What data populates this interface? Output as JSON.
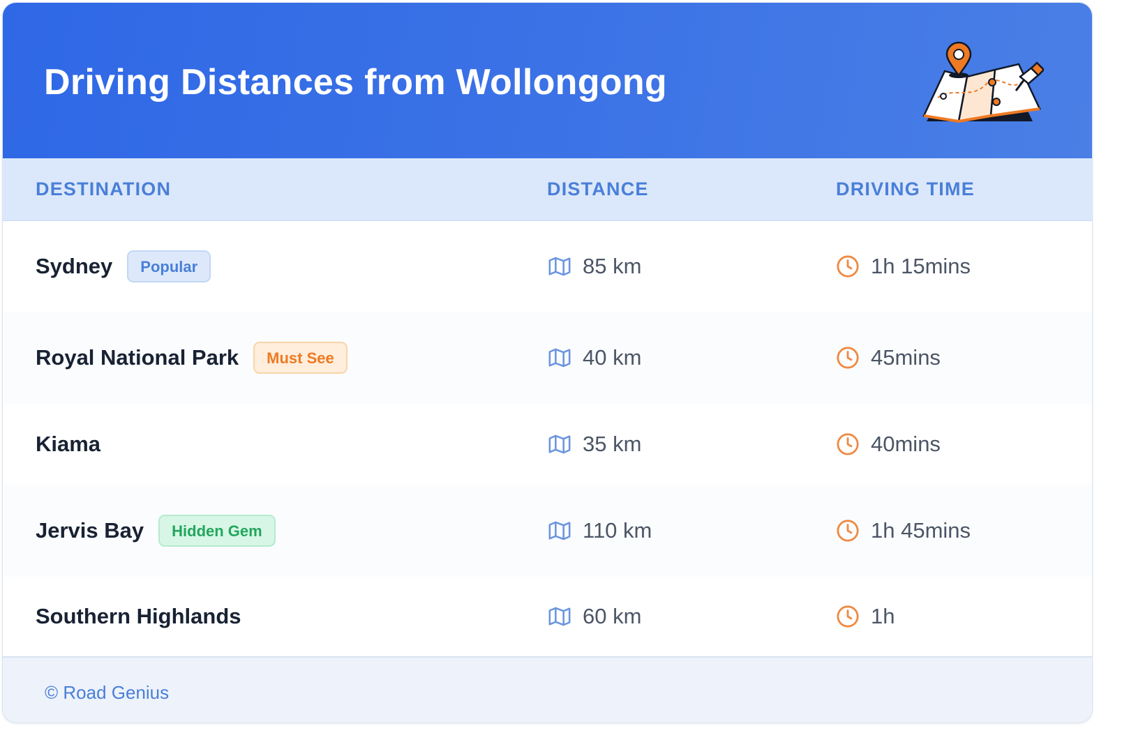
{
  "header": {
    "title": "Driving Distances from Wollongong",
    "illustration": "map-with-pins-icon"
  },
  "table": {
    "columns": [
      "DESTINATION",
      "DISTANCE",
      "DRIVING TIME"
    ],
    "rows": [
      {
        "destination": "Sydney",
        "badge": "Popular",
        "badge_color": "#4a7fd8",
        "distance": "85 km",
        "time": "1h 15mins"
      },
      {
        "destination": "Royal National Park",
        "badge": "Must See",
        "badge_color": "#ee7a23",
        "distance": "40 km",
        "time": "45mins"
      },
      {
        "destination": "Kiama",
        "badge": "",
        "badge_color": "",
        "distance": "35 km",
        "time": "40mins"
      },
      {
        "destination": "Jervis Bay",
        "badge": "Hidden Gem",
        "badge_color": "#22a65d",
        "distance": "110 km",
        "time": "1h 45mins"
      },
      {
        "destination": "Southern Highlands",
        "badge": "",
        "badge_color": "",
        "distance": "60 km",
        "time": "1h"
      }
    ],
    "icons": {
      "distance": "map-icon",
      "time": "clock-icon"
    }
  },
  "footer": {
    "text": "© Road Genius"
  },
  "colors": {
    "header_gradient_start": "#2f68e6",
    "header_gradient_end": "#4a7fe6",
    "accent_blue": "#4a7fd8",
    "accent_orange": "#ee7a23"
  }
}
